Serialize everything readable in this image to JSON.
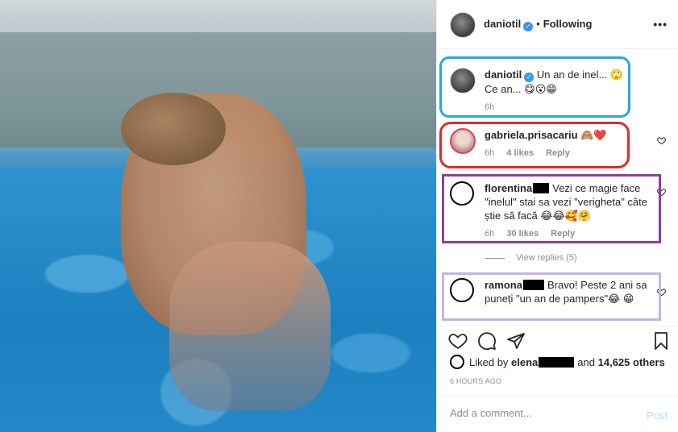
{
  "post": {
    "author": "daniotil",
    "follow_dot": "•",
    "follow_state": "Following",
    "more_label": "•••",
    "verified_mark": "✓"
  },
  "comments": {
    "caption": {
      "username": "daniotil",
      "text_line1": "Un an de inel... 🙄",
      "text_line2": "Ce an... 😋😮😁",
      "time": "6h"
    },
    "c1": {
      "username": "gabriela.prisacariu",
      "text": "🙈❤️",
      "time": "6h",
      "likes": "4 likes",
      "reply": "Reply"
    },
    "c2": {
      "username": "florentina",
      "text": "Vezi ce magie face \"inelul\" stai sa vezi \"verigheta\" câte știe să facă 😂😂🥰🤗",
      "time": "6h",
      "likes": "30 likes",
      "reply": "Reply"
    },
    "view_replies": "View replies (5)",
    "c3": {
      "username": "ramona",
      "text": "Bravo! Peste 2 ani sa puneți \"un an de pampers\"😂 😁"
    }
  },
  "likes": {
    "prefix": "Liked by",
    "user": "elena",
    "conj": "and",
    "count": "14,625 others"
  },
  "timestamp": "6 HOURS AGO",
  "add_comment": {
    "placeholder": "Add a comment...",
    "post_label": "Post"
  },
  "colors": {
    "highlight_caption": "#2aa6e0",
    "highlight_first_comment": "#e22a2a",
    "highlight_second_comment": "#8e3e9c",
    "highlight_third_comment": "#c7b3e0",
    "verified": "#3897f0",
    "post_button_disabled": "#b2dffc"
  },
  "icons": {
    "like": "heart-outline-icon",
    "comment": "speech-bubble-icon",
    "share": "paper-plane-icon",
    "save": "bookmark-icon",
    "comment_like": "small-heart-icon"
  }
}
